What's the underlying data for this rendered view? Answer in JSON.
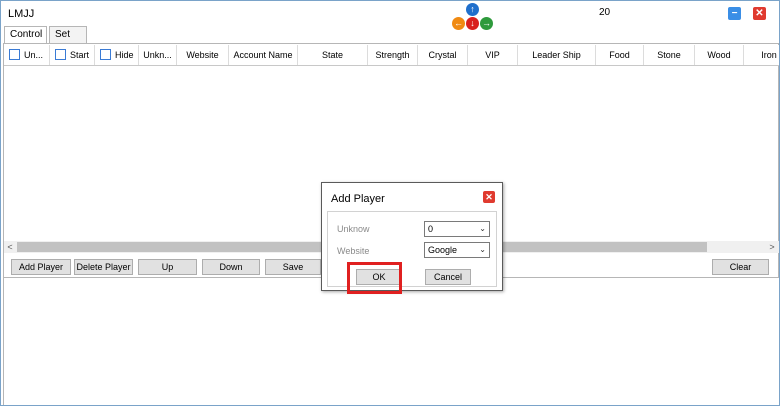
{
  "window": {
    "title": "LMJJ",
    "counter": "20"
  },
  "tabs": [
    {
      "label": "Control"
    },
    {
      "label": "Set"
    }
  ],
  "grid": {
    "columns": [
      "Un...",
      "Start",
      "Hide",
      "Unkn...",
      "Website",
      "Account Name",
      "State",
      "Strength",
      "Crystal",
      "VIP",
      "Leader Ship",
      "Food",
      "Stone",
      "Wood",
      "Iron"
    ]
  },
  "scroll": {
    "left": "<",
    "right": ">"
  },
  "toolbar": {
    "add_player": "Add Player",
    "delete_player": "Delete Player",
    "up": "Up",
    "down": "Down",
    "save": "Save",
    "clear": "Clear"
  },
  "dialog": {
    "title": "Add Player",
    "fields": [
      {
        "label": "Unknow",
        "value": "0"
      },
      {
        "label": "Website",
        "value": "Google"
      }
    ],
    "ok": "OK",
    "cancel": "Cancel"
  },
  "icons": {
    "up": "↑",
    "left": "←",
    "down": "↓",
    "right": "→",
    "minimize": "−",
    "close": "✕",
    "caret": "⌄"
  },
  "colors": {
    "highlight": "#e02020",
    "checkbox": "#3a7bd5",
    "close": "#e03a2f",
    "minimize": "#3a8ee6"
  }
}
